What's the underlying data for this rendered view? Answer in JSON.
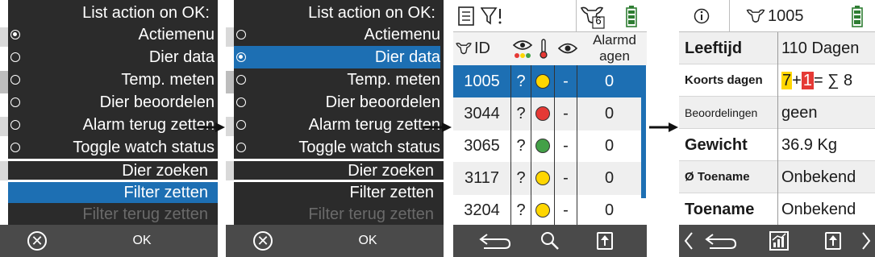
{
  "menu_screens": [
    {
      "title": "List action on OK:",
      "options": [
        {
          "label": "Actiemenu",
          "checked": true,
          "selected": false
        },
        {
          "label": "Dier data",
          "checked": false,
          "selected": false
        },
        {
          "label": "Temp. meten",
          "checked": false,
          "selected": false
        },
        {
          "label": "Dier beoordelen",
          "checked": false,
          "selected": false
        },
        {
          "label": "Alarm terug zetten",
          "checked": false,
          "selected": false
        },
        {
          "label": "Toggle watch status",
          "checked": false,
          "selected": false
        }
      ],
      "actions": [
        {
          "label": "Dier zoeken",
          "state": "normal"
        },
        {
          "label": "Filter zetten",
          "state": "highlighted"
        },
        {
          "label": "Filter terug zetten",
          "state": "disabled"
        }
      ],
      "ok_label": "OK"
    },
    {
      "title": "List action on OK:",
      "options": [
        {
          "label": "Actiemenu",
          "checked": false,
          "selected": false
        },
        {
          "label": "Dier data",
          "checked": true,
          "selected": true
        },
        {
          "label": "Temp. meten",
          "checked": false,
          "selected": false
        },
        {
          "label": "Dier beoordelen",
          "checked": false,
          "selected": false
        },
        {
          "label": "Alarm terug zetten",
          "checked": false,
          "selected": false
        },
        {
          "label": "Toggle watch status",
          "checked": false,
          "selected": false
        }
      ],
      "actions": [
        {
          "label": "Dier zoeken",
          "state": "normal"
        },
        {
          "label": "Filter zetten",
          "state": "normal"
        },
        {
          "label": "Filter terug zetten",
          "state": "disabled"
        }
      ],
      "ok_label": "OK"
    }
  ],
  "table_screen": {
    "header_count": "6",
    "columns": {
      "id": "ID",
      "alarm": "Alarmdagen"
    },
    "rows": [
      {
        "id": "1005",
        "q": "?",
        "status": "yellow",
        "dash": "-",
        "alarm": "0",
        "selected": true
      },
      {
        "id": "3044",
        "q": "?",
        "status": "red",
        "dash": "-",
        "alarm": "0",
        "selected": false
      },
      {
        "id": "3065",
        "q": "?",
        "status": "green",
        "dash": "-",
        "alarm": "0",
        "selected": false
      },
      {
        "id": "3117",
        "q": "?",
        "status": "yellow",
        "dash": "-",
        "alarm": "0",
        "selected": false
      },
      {
        "id": "3204",
        "q": "?",
        "status": "yellow",
        "dash": "-",
        "alarm": "0",
        "selected": false
      }
    ]
  },
  "detail_screen": {
    "animal_id": "1005",
    "rows": [
      {
        "key": "Leeftijd",
        "value": "110 Dagen"
      },
      {
        "key": "Koorts dagen",
        "value_a": "7",
        "plus": "+",
        "value_b": "1",
        "equals": "= ∑ 8"
      },
      {
        "key": "Beoordelingen",
        "value": "geen"
      },
      {
        "key": "Gewicht",
        "value": "36.9 Kg"
      },
      {
        "key": "Ø Toename",
        "value": "Onbekend"
      },
      {
        "key": "Toename",
        "value": "Onbekend"
      }
    ]
  },
  "colors": {
    "selection": "#1d6fb3",
    "menu_bg": "#2b2b2b",
    "bar_bg": "#4a4a4a",
    "highlight_yellow": "#ffd600",
    "highlight_red": "#e53935",
    "battery_green": "#2e7d32"
  },
  "icons": [
    "cancel-circle-icon",
    "back-arrow-icon",
    "search-icon",
    "export-icon",
    "info-icon",
    "cow-head-icon",
    "battery-icon",
    "filter-icon",
    "list-icon",
    "eye-icon",
    "thermometer-icon",
    "chart-icon",
    "chevron-left-icon",
    "chevron-right-icon"
  ]
}
